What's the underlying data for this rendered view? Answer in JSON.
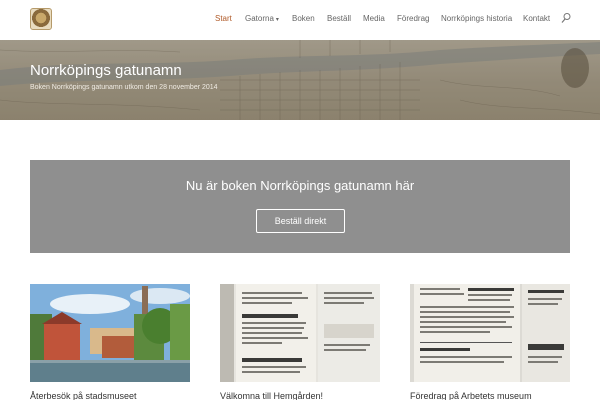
{
  "header": {
    "logo_icon": "seal-logo",
    "nav": [
      {
        "label": "Start",
        "active": true
      },
      {
        "label": "Gatorna",
        "has_dropdown": true
      },
      {
        "label": "Boken"
      },
      {
        "label": "Beställ"
      },
      {
        "label": "Media"
      },
      {
        "label": "Föredrag"
      },
      {
        "label": "Norrköpings historia"
      },
      {
        "label": "Kontakt"
      }
    ],
    "search_icon": "search-icon"
  },
  "hero": {
    "title": "Norrköpings gatunamn",
    "subtitle": "Boken Norrköpings gatunamn utkom den 28 november 2014"
  },
  "cta": {
    "heading": "Nu är boken Norrköpings gatunamn här",
    "button_label": "Beställ direkt"
  },
  "posts": [
    {
      "title": "Återbesök på stadsmuseet"
    },
    {
      "title": "Välkomna till Hemgården!"
    },
    {
      "title": "Föredrag på Arbetets museum"
    }
  ],
  "colors": {
    "accent": "#b05a28",
    "cta_bg": "#8f8f8f",
    "nav_text": "#666666"
  }
}
